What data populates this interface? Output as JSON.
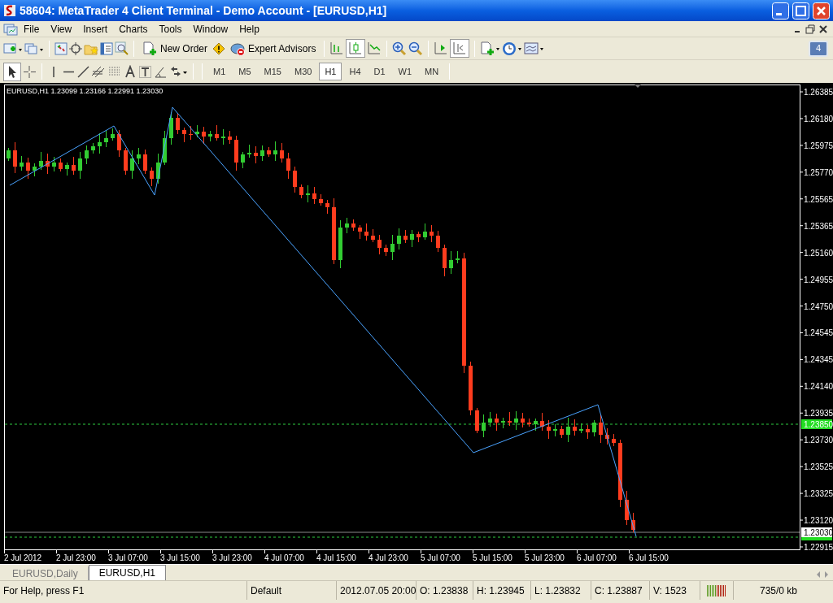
{
  "window": {
    "title": "58604: MetaTrader 4 Client Terminal - Demo Account - [EURUSD,H1]"
  },
  "menu": [
    "File",
    "View",
    "Insert",
    "Charts",
    "Tools",
    "Window",
    "Help"
  ],
  "toolbar": {
    "new_order": "New Order",
    "expert_advisors": "Expert Advisors",
    "notification_count": "4"
  },
  "timeframes": [
    {
      "label": "M1",
      "selected": false
    },
    {
      "label": "M5",
      "selected": false
    },
    {
      "label": "M15",
      "selected": false
    },
    {
      "label": "M30",
      "selected": false
    },
    {
      "label": "H1",
      "selected": true
    },
    {
      "label": "H4",
      "selected": false
    },
    {
      "label": "D1",
      "selected": false
    },
    {
      "label": "W1",
      "selected": false
    },
    {
      "label": "MN",
      "selected": false
    }
  ],
  "chart": {
    "info": "EURUSD,H1  1.23099 1.23166 1.22991 1.23030",
    "price_labels": [
      "1.26385",
      "1.26180",
      "1.25975",
      "1.25770",
      "1.25565",
      "1.25365",
      "1.25160",
      "1.24955",
      "1.24750",
      "1.24545",
      "1.24345",
      "1.24140",
      "1.23935",
      "1.23730",
      "1.23525",
      "1.23325",
      "1.23120",
      "1.22915"
    ],
    "price_markers": [
      {
        "text": "1.23850",
        "kind": "bid"
      },
      {
        "text": "1.23030",
        "kind": "last"
      }
    ],
    "time_labels": [
      "2 Jul 2012",
      "2 Jul 23:00",
      "3 Jul 07:00",
      "3 Jul 15:00",
      "3 Jul 23:00",
      "4 Jul 07:00",
      "4 Jul 15:00",
      "4 Jul 23:00",
      "5 Jul 07:00",
      "5 Jul 15:00",
      "5 Jul 23:00",
      "6 Jul 07:00",
      "6 Jul 15:00"
    ]
  },
  "chart_tabs": [
    {
      "label": "EURUSD,Daily",
      "selected": false
    },
    {
      "label": "EURUSD,H1",
      "selected": true
    }
  ],
  "status_bar": {
    "help": "For Help, press F1",
    "profile": "Default",
    "time": "2012.07.05 20:00",
    "open": "O: 1.23838",
    "high": "H: 1.23945",
    "low": "L: 1.23832",
    "close": "C: 1.23887",
    "volume": "V: 1523",
    "traffic": "735/0 kb"
  }
}
